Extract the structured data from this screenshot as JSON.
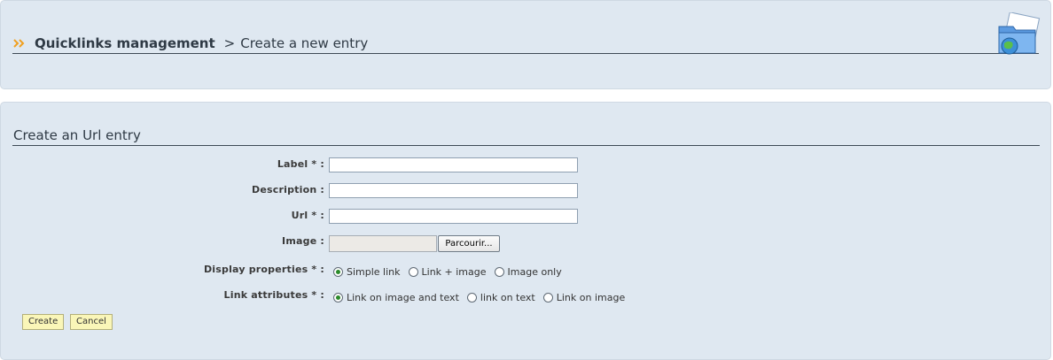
{
  "header": {
    "breadcrumb_root": "Quicklinks management",
    "breadcrumb_separator": ">",
    "breadcrumb_current": "Create a new entry",
    "folder_icon": "folder-globe-icon",
    "arrow_icon": "double-chevron-right-icon",
    "accent_color": "#f0a020"
  },
  "form": {
    "title": "Create an Url entry",
    "fields": {
      "label": {
        "label": "Label * :",
        "value": ""
      },
      "description": {
        "label": "Description :",
        "value": ""
      },
      "url": {
        "label": "Url * :",
        "value": ""
      },
      "image": {
        "label": "Image :",
        "browse_label": "Parcourir..."
      }
    },
    "display_properties": {
      "label": "Display properties * :",
      "options": [
        "Simple link",
        "Link + image",
        "Image only"
      ],
      "selected": "Simple link"
    },
    "link_attributes": {
      "label": "Link attributes * :",
      "options": [
        "Link on image and text",
        "link on text",
        "Link on image"
      ],
      "selected": "Link on image and text"
    },
    "buttons": {
      "create": "Create",
      "cancel": "Cancel"
    }
  }
}
